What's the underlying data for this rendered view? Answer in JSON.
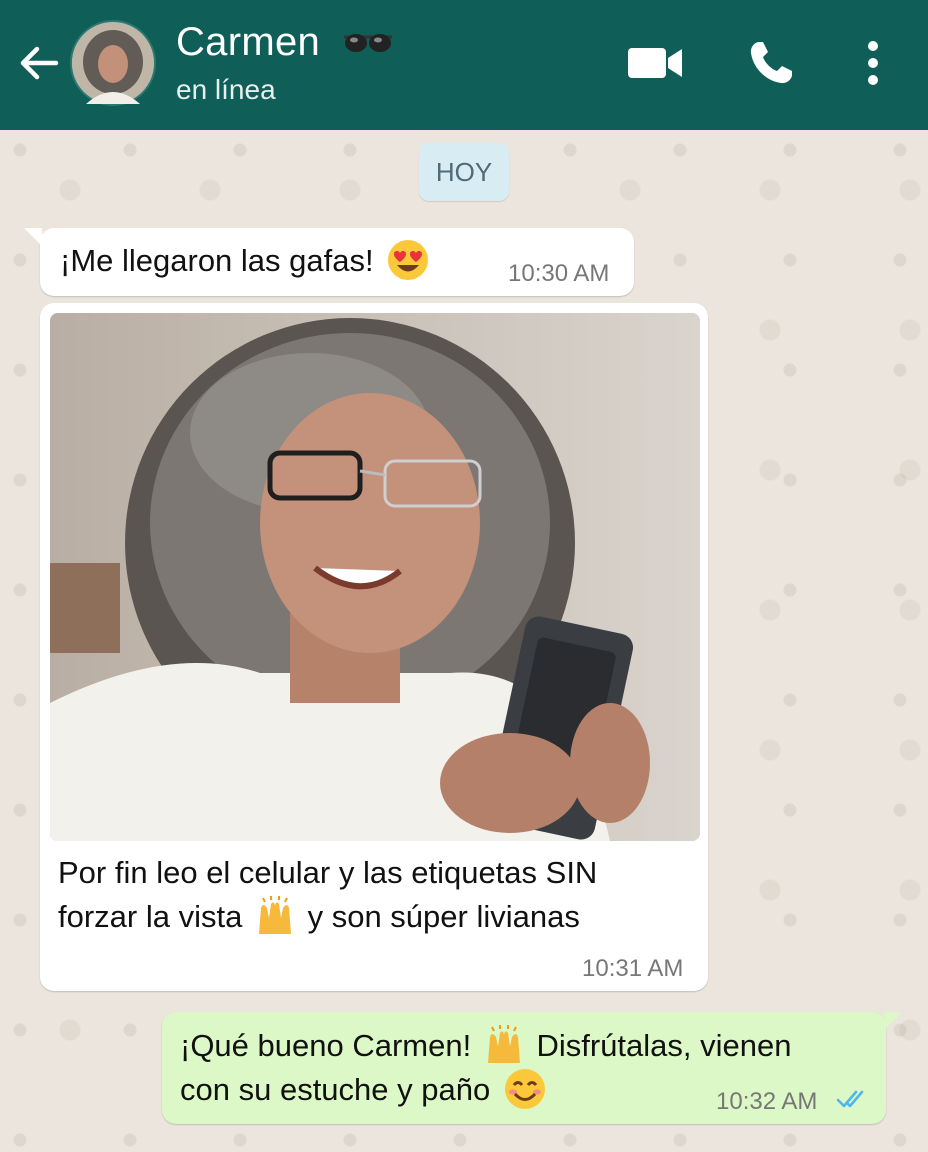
{
  "header": {
    "contact_name": "Carmen",
    "status": "en línea",
    "colors": {
      "bar": "#0f5e57",
      "accent": "#ffffff"
    },
    "icons": [
      "back-arrow-icon",
      "glasses-icon",
      "video-call-icon",
      "phone-icon",
      "more-options-icon"
    ]
  },
  "chat": {
    "date_label": "HOY",
    "messages": [
      {
        "direction": "in",
        "text": "¡Me llegaron las gafas!",
        "emoji": "heart-eyes",
        "time": "10:30 AM"
      },
      {
        "direction": "in",
        "type": "image",
        "caption_line1": "Por fin leo el celular y las etiquetas SIN",
        "caption_line2_a": "forzar la vista",
        "caption_line2_b": "y son súper livianas",
        "emoji": "raised-hands",
        "time": "10:31 AM"
      },
      {
        "direction": "out",
        "text_line1_a": "¡Qué bueno Carmen!",
        "text_line1_b": "Disfrútalas, vienen",
        "text_line2": "con su estuche y paño",
        "emojis": [
          "raised-hands",
          "smiling-face"
        ],
        "time": "10:32 AM",
        "read_ticks": "double-check-blue"
      }
    ],
    "colors": {
      "incoming": "#ffffff",
      "outgoing": "#dcf8c6",
      "read_tick": "#4fb6ec"
    }
  }
}
